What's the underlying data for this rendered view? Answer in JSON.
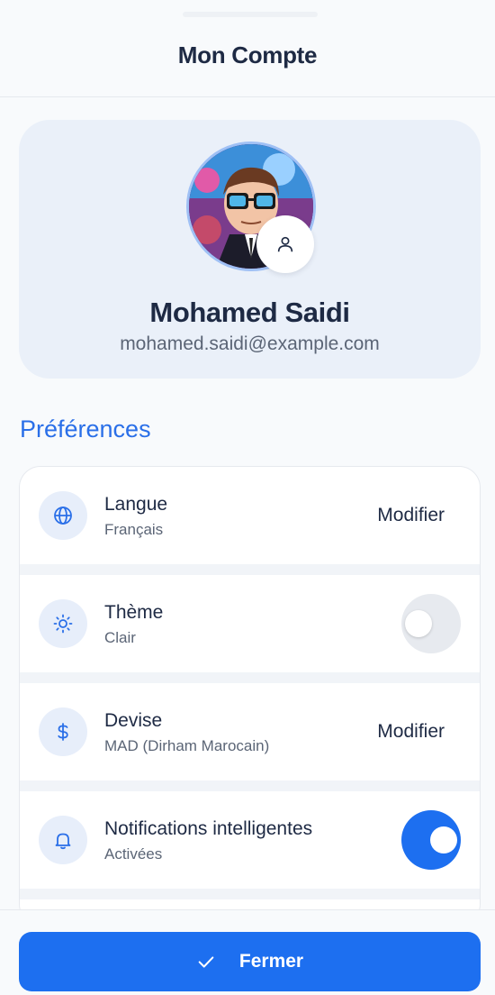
{
  "header": {
    "title": "Mon Compte"
  },
  "profile": {
    "name": "Mohamed Saidi",
    "email": "mohamed.saidi@example.com",
    "avatar_icon": "cartoon-avatar",
    "edit_icon": "user-icon"
  },
  "preferences": {
    "title": "Préférences",
    "items": [
      {
        "label": "Langue",
        "value": "Français",
        "icon": "globe-icon",
        "action": "Modifier"
      },
      {
        "label": "Thème",
        "value": "Clair",
        "icon": "sun-icon",
        "toggle": false
      },
      {
        "label": "Devise",
        "value": "MAD (Dirham Marocain)",
        "icon": "dollar-icon",
        "action": "Modifier"
      },
      {
        "label": "Notifications intelligentes",
        "value": "Activées",
        "icon": "bell-icon",
        "toggle": true
      }
    ]
  },
  "footer": {
    "close_label": "Fermer",
    "close_icon": "check-icon"
  },
  "colors": {
    "accent": "#1d6ff0",
    "title_blue": "#2a6fe8",
    "text": "#1e2a44",
    "muted": "#5b6576",
    "card": "#eaf0f9"
  }
}
